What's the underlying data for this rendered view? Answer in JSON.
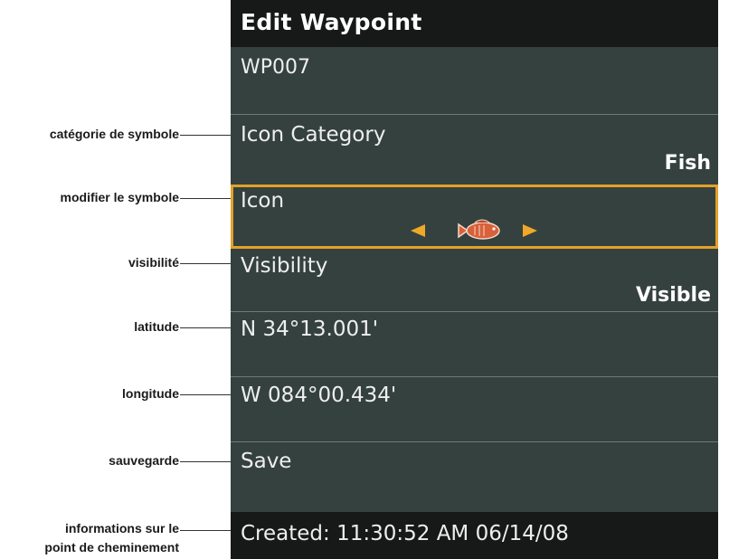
{
  "annotations": {
    "icon_category": "catégorie de symbole",
    "icon": "modifier le symbole",
    "visibility": "visibilité",
    "latitude": "latitude",
    "longitude": "longitude",
    "save": "sauvegarde",
    "info_line1": "informations sur le",
    "info_line2": "point de cheminement"
  },
  "panel": {
    "title": "Edit Waypoint",
    "name": "WP007",
    "icon_category": {
      "label": "Icon Category",
      "value": "Fish"
    },
    "icon": {
      "label": "Icon",
      "symbol": "fish-icon"
    },
    "visibility": {
      "label": "Visibility",
      "value": "Visible"
    },
    "latitude": "N 34°13.001'",
    "longitude": "W 084°00.434'",
    "save": "Save",
    "created": "Created: 11:30:52 AM 06/14/08"
  },
  "colors": {
    "panel_bg": "#35413f",
    "bar_bg": "#161918",
    "highlight": "#e2a228"
  }
}
